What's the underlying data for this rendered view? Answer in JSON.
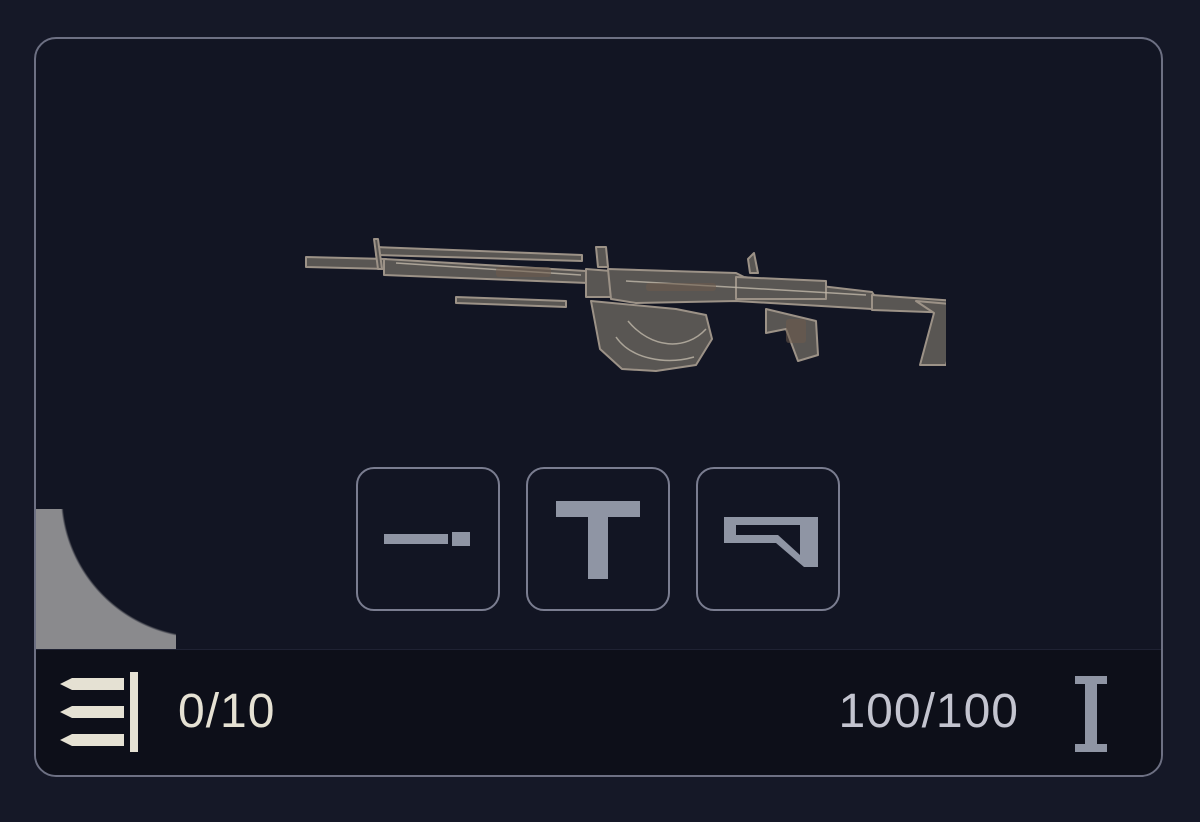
{
  "hud": {
    "ammo": "0/10",
    "durability": "100/100"
  },
  "icons": {
    "ammo": "ammo-magazine-icon",
    "tier": "tier-1-icon",
    "barrel": "barrel-attachment-icon",
    "grip": "grip-attachment-icon",
    "stock": "stock-attachment-icon"
  },
  "colors": {
    "background": "#151827",
    "panel": "#121523",
    "border": "#6d7083",
    "text": "#e5e1d3",
    "icon": "#8f95a4"
  }
}
